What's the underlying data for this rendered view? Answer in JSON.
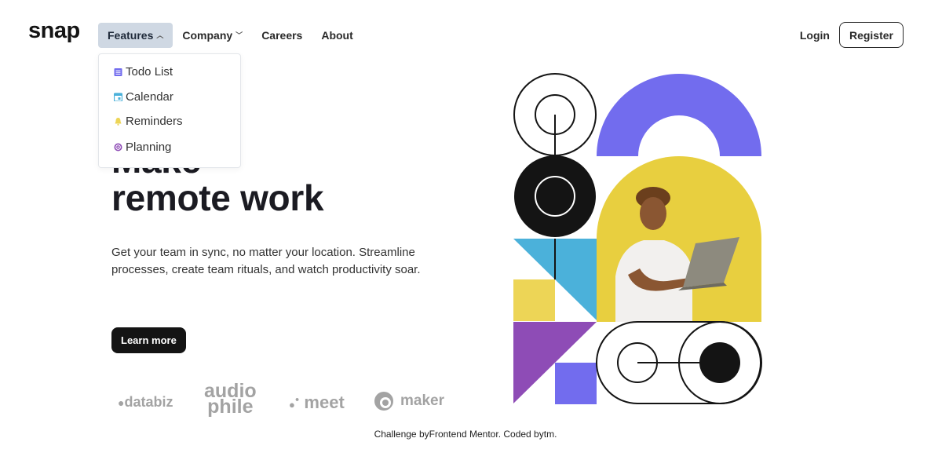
{
  "brand": {
    "logo": "snap"
  },
  "nav": {
    "items": [
      {
        "label": "Features",
        "caret": "^"
      },
      {
        "label": "Company",
        "caret": "v"
      },
      {
        "label": "Careers"
      },
      {
        "label": "About"
      }
    ],
    "active": "Features"
  },
  "auth": {
    "login": "Login",
    "register": "Register"
  },
  "features_menu": {
    "items": [
      {
        "label": "Todo List",
        "icon": "todo-list-icon",
        "color": "#726cee"
      },
      {
        "label": "Calendar",
        "icon": "calendar-icon",
        "color": "#4bb1da"
      },
      {
        "label": "Reminders",
        "icon": "bell-icon",
        "color": "#edd556"
      },
      {
        "label": "Planning",
        "icon": "planning-icon",
        "color": "#8e4cb6"
      }
    ]
  },
  "hero": {
    "headline_line1": "Make",
    "headline_line2": "remote work",
    "description": "Get your team in sync, no matter your location. Streamline processes, create team rituals, and watch productivity soar.",
    "cta": "Learn more"
  },
  "clients": [
    {
      "name": "databiz"
    },
    {
      "name": "audio"
    },
    {
      "name": "phile"
    },
    {
      "name": "meet"
    },
    {
      "name": "maker"
    }
  ],
  "footer": {
    "prefix": "Challenge by",
    "link1": "Frontend Mentor",
    "middle": ". Coded by",
    "author": "tm",
    "suffix": "."
  },
  "colors": {
    "blue_violet": "#726cee",
    "sky": "#4bb1da",
    "yellow": "#edd556",
    "purple": "#8e4cb6",
    "dark": "#141414"
  }
}
